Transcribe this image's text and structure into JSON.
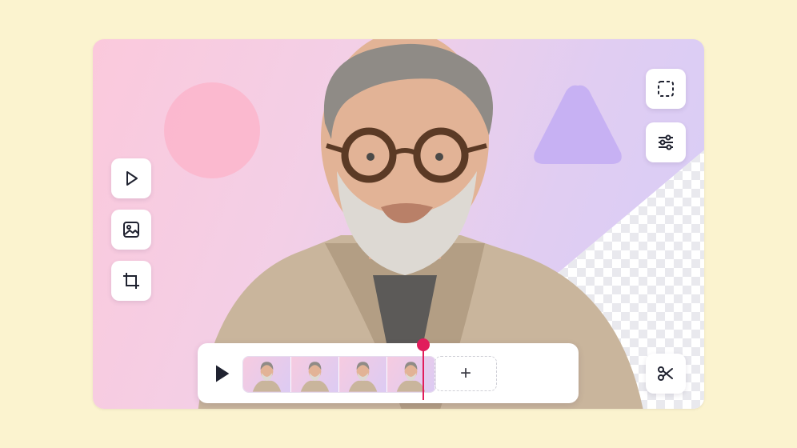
{
  "left_toolbar": {
    "items": [
      {
        "icon": "play-icon"
      },
      {
        "icon": "image-icon"
      },
      {
        "icon": "crop-icon"
      }
    ]
  },
  "right_toolbar": {
    "items": [
      {
        "icon": "selection-icon"
      },
      {
        "icon": "sliders-icon"
      }
    ]
  },
  "timeline": {
    "play_icon": "play-icon",
    "clip_count": 4,
    "add_label": "+"
  },
  "scissors_icon": "scissors-icon",
  "colors": {
    "background": "#fbf3cf",
    "accent": "#e11d5c",
    "circle": "#fbb5cb",
    "triangle": "#c7b1f3"
  }
}
